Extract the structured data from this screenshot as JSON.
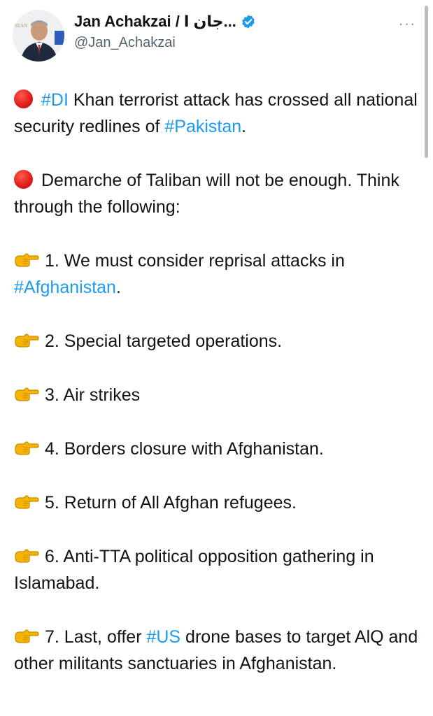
{
  "user": {
    "display_name": "Jan Achakzai / جان ا...",
    "handle": "@Jan_Achakzai",
    "verified": true,
    "avatar_logo_text": "SEAN"
  },
  "header": {
    "more_label": "···"
  },
  "tweet": {
    "paragraphs": [
      {
        "emoji": "red-circle-icon",
        "segments": [
          {
            "text": "#DI",
            "hashtag": true
          },
          {
            "text": " Khan terrorist attack  has crossed all national security redlines of ",
            "hashtag": false
          },
          {
            "text": "#Pakistan",
            "hashtag": true
          },
          {
            "text": ".",
            "hashtag": false
          }
        ]
      },
      {
        "emoji": "red-circle-icon",
        "segments": [
          {
            "text": "Demarche of Taliban will not be enough. Think through the following:",
            "hashtag": false
          }
        ]
      },
      {
        "emoji": "pointing-hand-icon",
        "segments": [
          {
            "text": "1. We must consider reprisal attacks in ",
            "hashtag": false
          },
          {
            "text": "#Afghanistan",
            "hashtag": true
          },
          {
            "text": ".",
            "hashtag": false
          }
        ]
      },
      {
        "emoji": "pointing-hand-icon",
        "segments": [
          {
            "text": "2. Special targeted operations.",
            "hashtag": false
          }
        ]
      },
      {
        "emoji": "pointing-hand-icon",
        "segments": [
          {
            "text": "3. Air strikes",
            "hashtag": false
          }
        ]
      },
      {
        "emoji": "pointing-hand-icon",
        "segments": [
          {
            "text": "4. Borders closure with Afghanistan.",
            "hashtag": false
          }
        ]
      },
      {
        "emoji": "pointing-hand-icon",
        "segments": [
          {
            "text": "5. Return of All Afghan refugees.",
            "hashtag": false
          }
        ]
      },
      {
        "emoji": "pointing-hand-icon",
        "segments": [
          {
            "text": "6. Anti-TTA political opposition gathering in Islamabad.",
            "hashtag": false
          }
        ]
      },
      {
        "emoji": "pointing-hand-icon",
        "segments": [
          {
            "text": "7. Last,  offer ",
            "hashtag": false
          },
          {
            "text": "#US",
            "hashtag": true
          },
          {
            "text": " drone bases to target AlQ and other militants sanctuaries in Afghanistan.",
            "hashtag": false
          }
        ]
      }
    ]
  },
  "colors": {
    "text": "#0f1419",
    "secondary": "#536471",
    "hashtag": "#1d9bf0",
    "verified_badge": "#1d9bf0"
  }
}
